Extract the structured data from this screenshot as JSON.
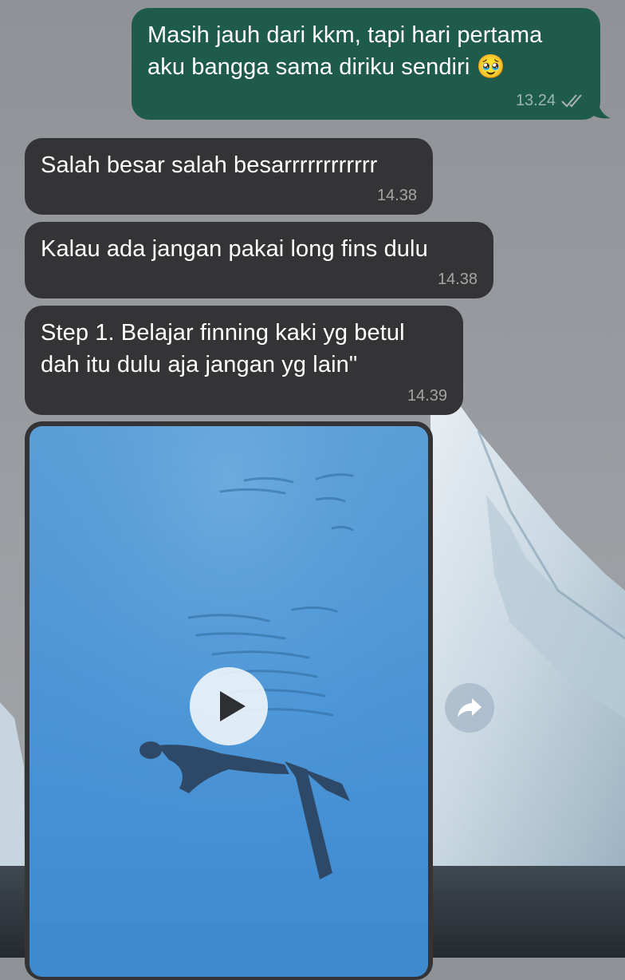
{
  "messages": [
    {
      "direction": "outgoing",
      "text": "Masih jauh dari kkm, tapi hari pertama\naku bangga sama diriku sendiri",
      "emoji": "🥹",
      "time": "13.24",
      "status": "read"
    },
    {
      "direction": "incoming",
      "text": "Salah besar salah besarrrrrrrrrrrr",
      "time": "14.38"
    },
    {
      "direction": "incoming",
      "text": "Kalau ada jangan pakai long fins dulu",
      "time": "14.38"
    },
    {
      "direction": "incoming",
      "text": "Step 1. Belajar finning kaki yg betul\ndah itu dulu aja jangan yg lain\"",
      "time": "14.39"
    }
  ],
  "video_message": {
    "direction": "incoming",
    "media_type": "video",
    "play_icon": "play-icon",
    "forward_icon": "forward-icon"
  },
  "colors": {
    "outgoing_bubble": "#1f5b4a",
    "incoming_bubble": "#343436",
    "text": "#ffffff",
    "meta_text": "#a9b3b0"
  }
}
